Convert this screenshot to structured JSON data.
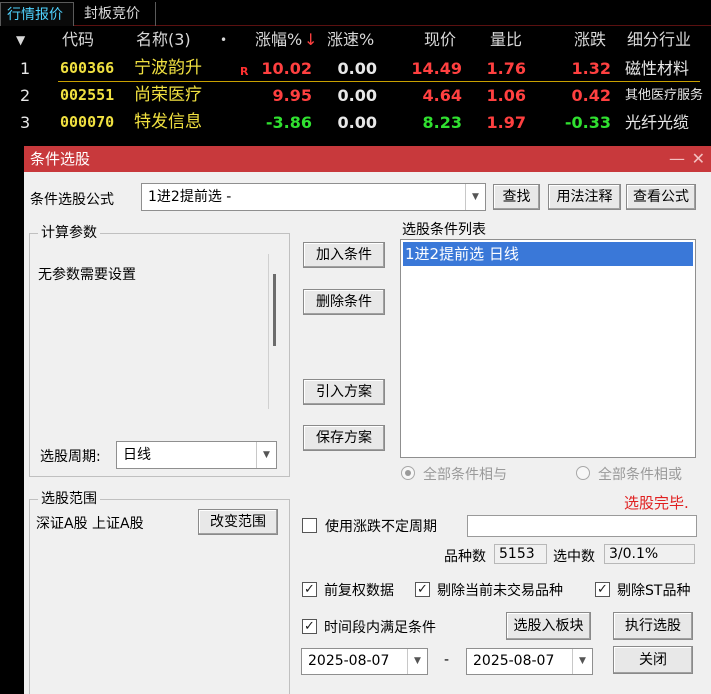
{
  "tabs": [
    "行情报价",
    "封板竞价"
  ],
  "quote_table": {
    "headers": {
      "sort": "▼",
      "code": "代码",
      "name": "名称(3)",
      "dot": "•",
      "change_pct": "涨幅%",
      "sort_down": "↓",
      "speed": "涨速%",
      "price": "现价",
      "vol_ratio": "量比",
      "change": "涨跌",
      "industry": "细分行业"
    },
    "rows": [
      {
        "no": "1",
        "code": "600366",
        "name": "宁波韵升",
        "flag": "R",
        "change_pct": "10.02",
        "speed": "0.00",
        "price": "14.49",
        "vol_ratio": "1.76",
        "change": "1.32",
        "industry": "磁性材料"
      },
      {
        "no": "2",
        "code": "002551",
        "name": "尚荣医疗",
        "flag": "",
        "change_pct": "9.95",
        "speed": "0.00",
        "price": "4.64",
        "vol_ratio": "1.06",
        "change": "0.42",
        "industry": "其他医疗服务"
      },
      {
        "no": "3",
        "code": "000070",
        "name": "特发信息",
        "flag": "",
        "change_pct": "-3.86",
        "speed": "0.00",
        "price": "8.23",
        "vol_ratio": "1.97",
        "change": "-0.33",
        "industry": "光纤光缆"
      }
    ]
  },
  "dialog": {
    "title": "条件选股",
    "min_glyph": "—",
    "close_glyph": "✕",
    "formula_label": "条件选股公式",
    "formula_value": "1进2提前选  -",
    "btn_find": "查找",
    "btn_usage": "用法注释",
    "btn_view": "查看公式",
    "params_group": "计算参数",
    "params_text": "无参数需要设置",
    "period_label": "选股周期:",
    "period_value": "日线",
    "btn_add": "加入条件",
    "btn_delete": "删除条件",
    "btn_import": "引入方案",
    "btn_save": "保存方案",
    "cond_list_label": "选股条件列表",
    "cond_items": [
      "1进2提前选  日线"
    ],
    "radio_and": "全部条件相与",
    "radio_or": "全部条件相或",
    "status": "选股完毕.",
    "range_group": "选股范围",
    "range_text": "深证A股 上证A股",
    "btn_change_range": "改变范围",
    "use_period_label": "使用涨跌不定周期",
    "count_label": "品种数",
    "count_value": "5153",
    "selected_label": "选中数",
    "selected_value": "3/0.1%",
    "chk_fq": "前复权数据",
    "chk_exclude_untraded": "剔除当前未交易品种",
    "chk_exclude_st": "剔除ST品种",
    "chk_time_range": "时间段内满足条件",
    "btn_to_block": "选股入板块",
    "btn_execute": "执行选股",
    "date_from": "2025-08-07",
    "date_sep": "-",
    "date_to": "2025-08-07",
    "btn_close": "关闭",
    "check_glyph": "✓",
    "arrow_glyph": "▼"
  },
  "colors": {
    "title_bar": "#c8393c",
    "up": "#ff4040",
    "down": "#30e030",
    "code": "#f0e040",
    "tab_active": "#4fd3ff",
    "status": "#e02020",
    "selection": "#3a78d8"
  }
}
